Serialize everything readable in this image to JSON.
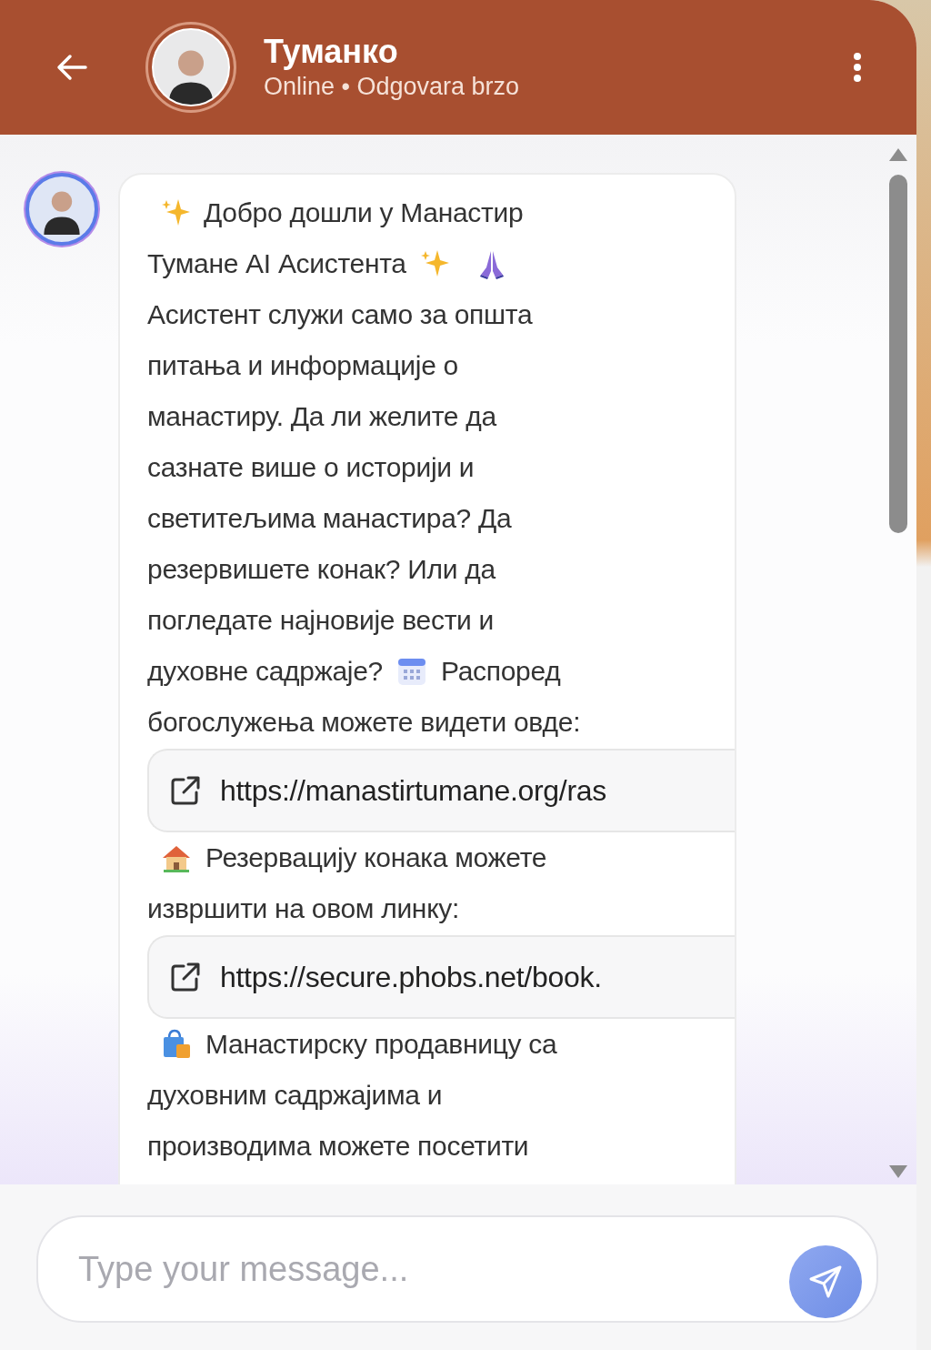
{
  "header": {
    "name": "Туманко",
    "status": "Online • Odgovara brzo"
  },
  "message": {
    "parts": [
      {
        "kind": "line",
        "segments": [
          {
            "kind": "sparkle"
          },
          {
            "kind": "text",
            "text": "Добро дошли у Манастир"
          }
        ]
      },
      {
        "kind": "line",
        "segments": [
          {
            "kind": "text",
            "text": "Тумане AI Асистента"
          },
          {
            "kind": "sparkle"
          },
          {
            "kind": "praying"
          }
        ]
      },
      {
        "kind": "line",
        "segments": [
          {
            "kind": "text",
            "text": "Асистент служи само за општа"
          }
        ]
      },
      {
        "kind": "line",
        "segments": [
          {
            "kind": "text",
            "text": "питања и информације о"
          }
        ]
      },
      {
        "kind": "line",
        "segments": [
          {
            "kind": "text",
            "text": "манастиру.  Да ли желите да"
          }
        ]
      },
      {
        "kind": "line",
        "segments": [
          {
            "kind": "text",
            "text": "сазнате више о историји и"
          }
        ]
      },
      {
        "kind": "line",
        "segments": [
          {
            "kind": "text",
            "text": "светитељима манастира? Да"
          }
        ]
      },
      {
        "kind": "line",
        "segments": [
          {
            "kind": "text",
            "text": "резервишете конак? Или да"
          }
        ]
      },
      {
        "kind": "line",
        "segments": [
          {
            "kind": "text",
            "text": "погледате најновије вести и"
          }
        ]
      },
      {
        "kind": "line",
        "segments": [
          {
            "kind": "text",
            "text": "духовне садржаје?"
          },
          {
            "kind": "calendar"
          },
          {
            "kind": "text",
            "text": "Распоред"
          }
        ]
      },
      {
        "kind": "line",
        "segments": [
          {
            "kind": "text",
            "text": "богослужења можете видети овде:"
          }
        ]
      },
      {
        "kind": "link",
        "url": "https://manastirtumane.org/ras"
      },
      {
        "kind": "line",
        "segments": [
          {
            "kind": "house"
          },
          {
            "kind": "text",
            "text": "Резервацију конака можете"
          }
        ]
      },
      {
        "kind": "line",
        "segments": [
          {
            "kind": "text",
            "text": "извршити на овом линку:"
          }
        ]
      },
      {
        "kind": "link",
        "url": "https://secure.phobs.net/book."
      },
      {
        "kind": "line",
        "segments": [
          {
            "kind": "bag"
          },
          {
            "kind": "text",
            "text": "Манастирску продавницу са"
          }
        ]
      },
      {
        "kind": "line",
        "segments": [
          {
            "kind": "text",
            "text": "духовним садржајима и"
          }
        ]
      },
      {
        "kind": "line",
        "segments": [
          {
            "kind": "text",
            "text": "производима можете посетити"
          }
        ]
      }
    ]
  },
  "composer": {
    "placeholder": "Type your message..."
  }
}
